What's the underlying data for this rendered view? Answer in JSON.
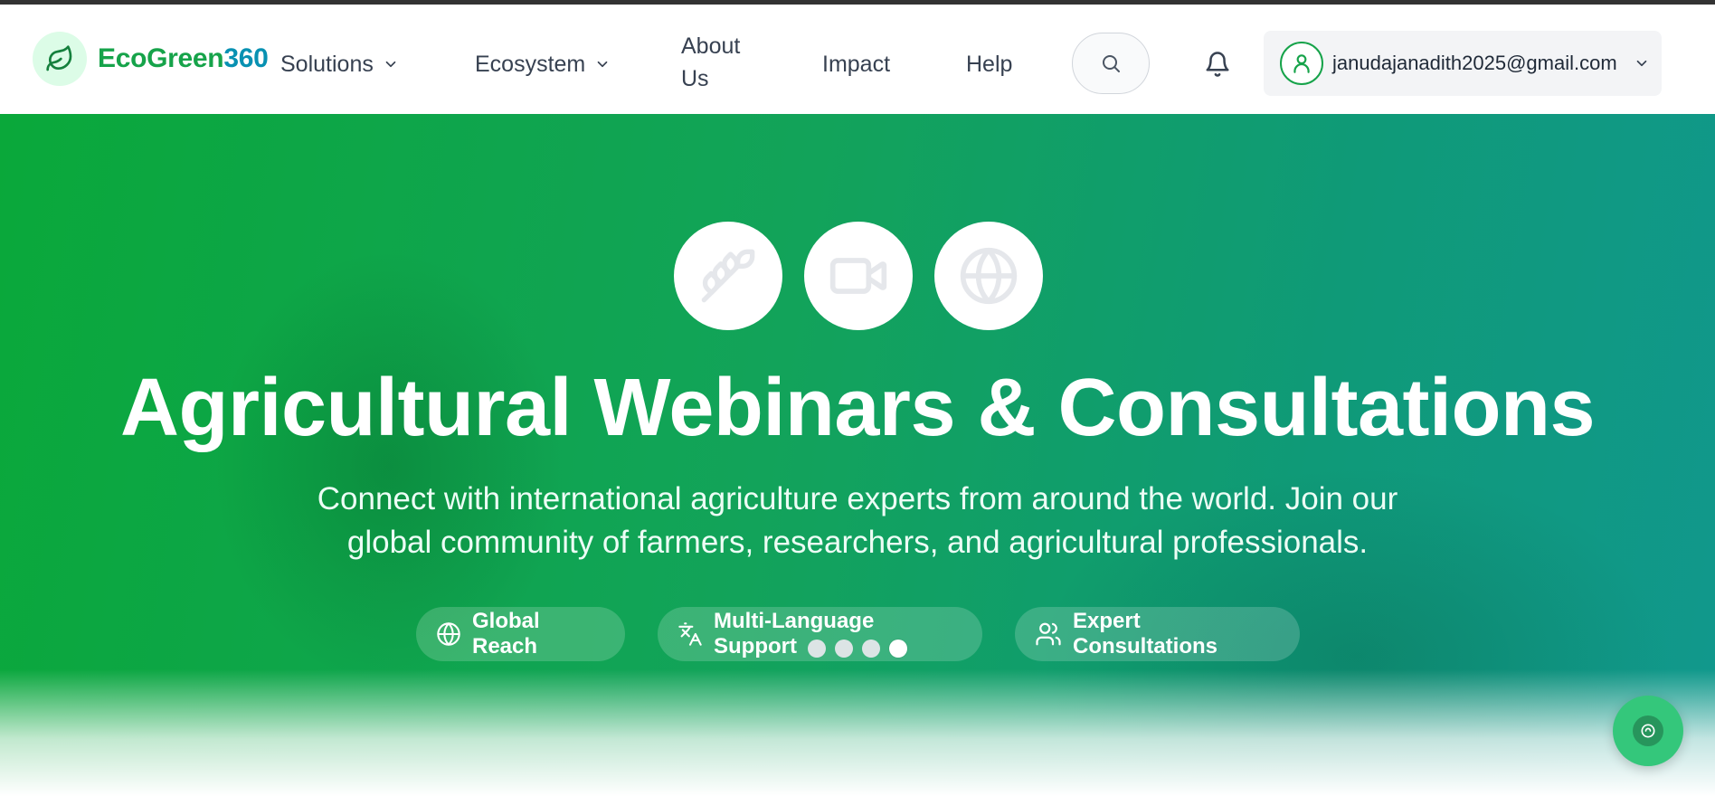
{
  "brand": {
    "name_part1": "EcoGreen",
    "name_part2": "360",
    "logo_icon": "leaf-icon"
  },
  "nav": {
    "solutions": "Solutions",
    "ecosystem": "Ecosystem",
    "about_line1": "About",
    "about_line2": "Us",
    "impact": "Impact",
    "help": "Help"
  },
  "header": {
    "search_icon": "search-icon",
    "notification_icon": "bell-icon",
    "user_email": "janudajanadith2025@gmail.com"
  },
  "hero": {
    "feature_icons": [
      "wheat-icon",
      "video-camera-icon",
      "globe-icon"
    ],
    "title": "Agricultural Webinars & Consultations",
    "subtitle_line1": "Connect with international agriculture experts from around the world. Join our",
    "subtitle_line2": "global community of farmers, researchers, and agricultural professionals.",
    "pills": [
      {
        "label": "Global Reach",
        "icon": "globe-icon"
      },
      {
        "label": "Multi-Language Support",
        "icon": "translate-icon"
      },
      {
        "label": "Expert Consultations",
        "icon": "users-icon"
      }
    ],
    "carousel": {
      "total_slides": 4,
      "active_slide": 4
    }
  },
  "colors": {
    "brand_green": "#16a34a",
    "brand_teal": "#0891b2",
    "hero_gradient_start": "#0aa83a",
    "hero_gradient_end": "#11988d",
    "chat_button": "#34c77b"
  }
}
